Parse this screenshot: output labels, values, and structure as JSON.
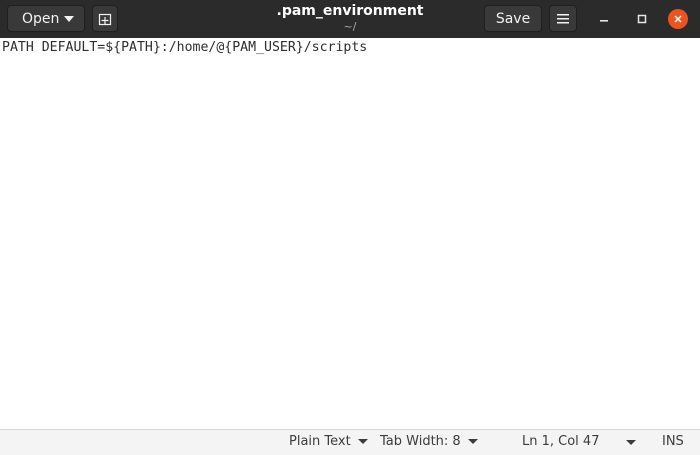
{
  "header": {
    "open_label": "Open",
    "save_label": "Save",
    "title": ".pam_environment",
    "subtitle": "~/"
  },
  "editor": {
    "lines": [
      "PATH DEFAULT=${PATH}:/home/@{PAM_USER}/scripts"
    ]
  },
  "statusbar": {
    "language": "Plain Text",
    "tab_width": "Tab Width: 8",
    "position": "Ln 1, Col 47",
    "mode": "INS"
  },
  "colors": {
    "headerbar": "#2b2b2b",
    "close_button": "#e95420"
  },
  "icons": {
    "new_tab": "new-tab-icon",
    "menu": "hamburger-menu-icon",
    "minimize": "minimize-icon",
    "maximize": "maximize-icon",
    "close": "close-icon"
  }
}
